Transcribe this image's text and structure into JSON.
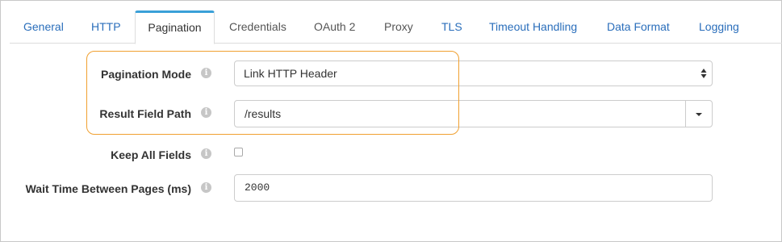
{
  "tabs": [
    {
      "label": "General",
      "state": "link"
    },
    {
      "label": "HTTP",
      "state": "link"
    },
    {
      "label": "Pagination",
      "state": "active"
    },
    {
      "label": "Credentials",
      "state": "muted"
    },
    {
      "label": "OAuth 2",
      "state": "muted"
    },
    {
      "label": "Proxy",
      "state": "muted"
    },
    {
      "label": "TLS",
      "state": "link"
    },
    {
      "label": "Timeout Handling",
      "state": "link"
    },
    {
      "label": "Data Format",
      "state": "link"
    },
    {
      "label": "Logging",
      "state": "link"
    }
  ],
  "form": {
    "pagination_mode": {
      "label": "Pagination Mode",
      "value": "Link HTTP Header"
    },
    "result_field_path": {
      "label": "Result Field Path",
      "value": "/results"
    },
    "keep_all_fields": {
      "label": "Keep All Fields",
      "checked": false
    },
    "wait_time": {
      "label": "Wait Time Between Pages (ms)",
      "value": "2000"
    }
  },
  "icons": {
    "info": "info-icon",
    "select_arrows": "select-arrows-icon",
    "caret": "caret-down-icon"
  },
  "colors": {
    "link": "#2a6ebb",
    "active_tab_top": "#3aa0d8",
    "highlight": "#f0a030",
    "info_icon": "#c6c6c6"
  }
}
